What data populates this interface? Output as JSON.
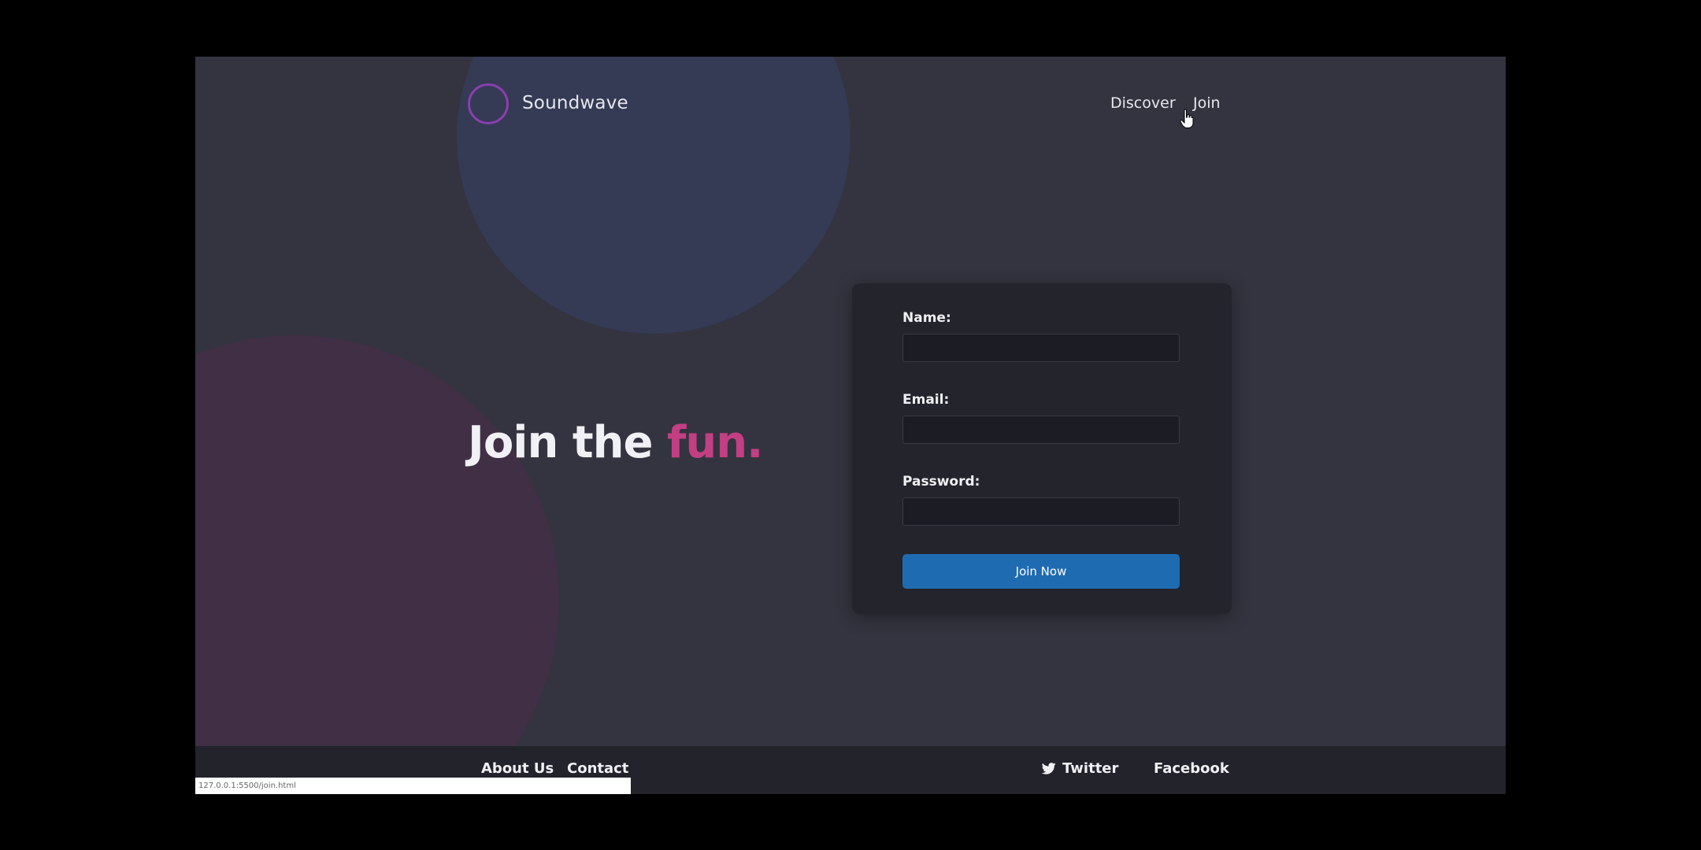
{
  "header": {
    "brand": "Soundwave",
    "nav": {
      "discover": "Discover",
      "join": "Join"
    }
  },
  "hero": {
    "title_prefix": "Join the ",
    "title_accent": "fun."
  },
  "form": {
    "name_label": "Name:",
    "email_label": "Email:",
    "password_label": "Password:",
    "name_value": "",
    "email_value": "",
    "password_value": "",
    "submit_label": "Join Now"
  },
  "footer": {
    "about": "About Us",
    "contact": "Contact",
    "twitter": "Twitter",
    "facebook": "Facebook"
  },
  "status_bar": {
    "url": "127.0.0.1:5500/join.html"
  },
  "colors": {
    "accent_pink": "#c23f84",
    "button_blue": "#1f6bb2",
    "background": "#33343f",
    "card": "#23242c"
  },
  "icons": {
    "logo": "soundwave-logo-icon",
    "twitter": "twitter-bird-icon",
    "cursor": "hand-pointer-icon"
  }
}
